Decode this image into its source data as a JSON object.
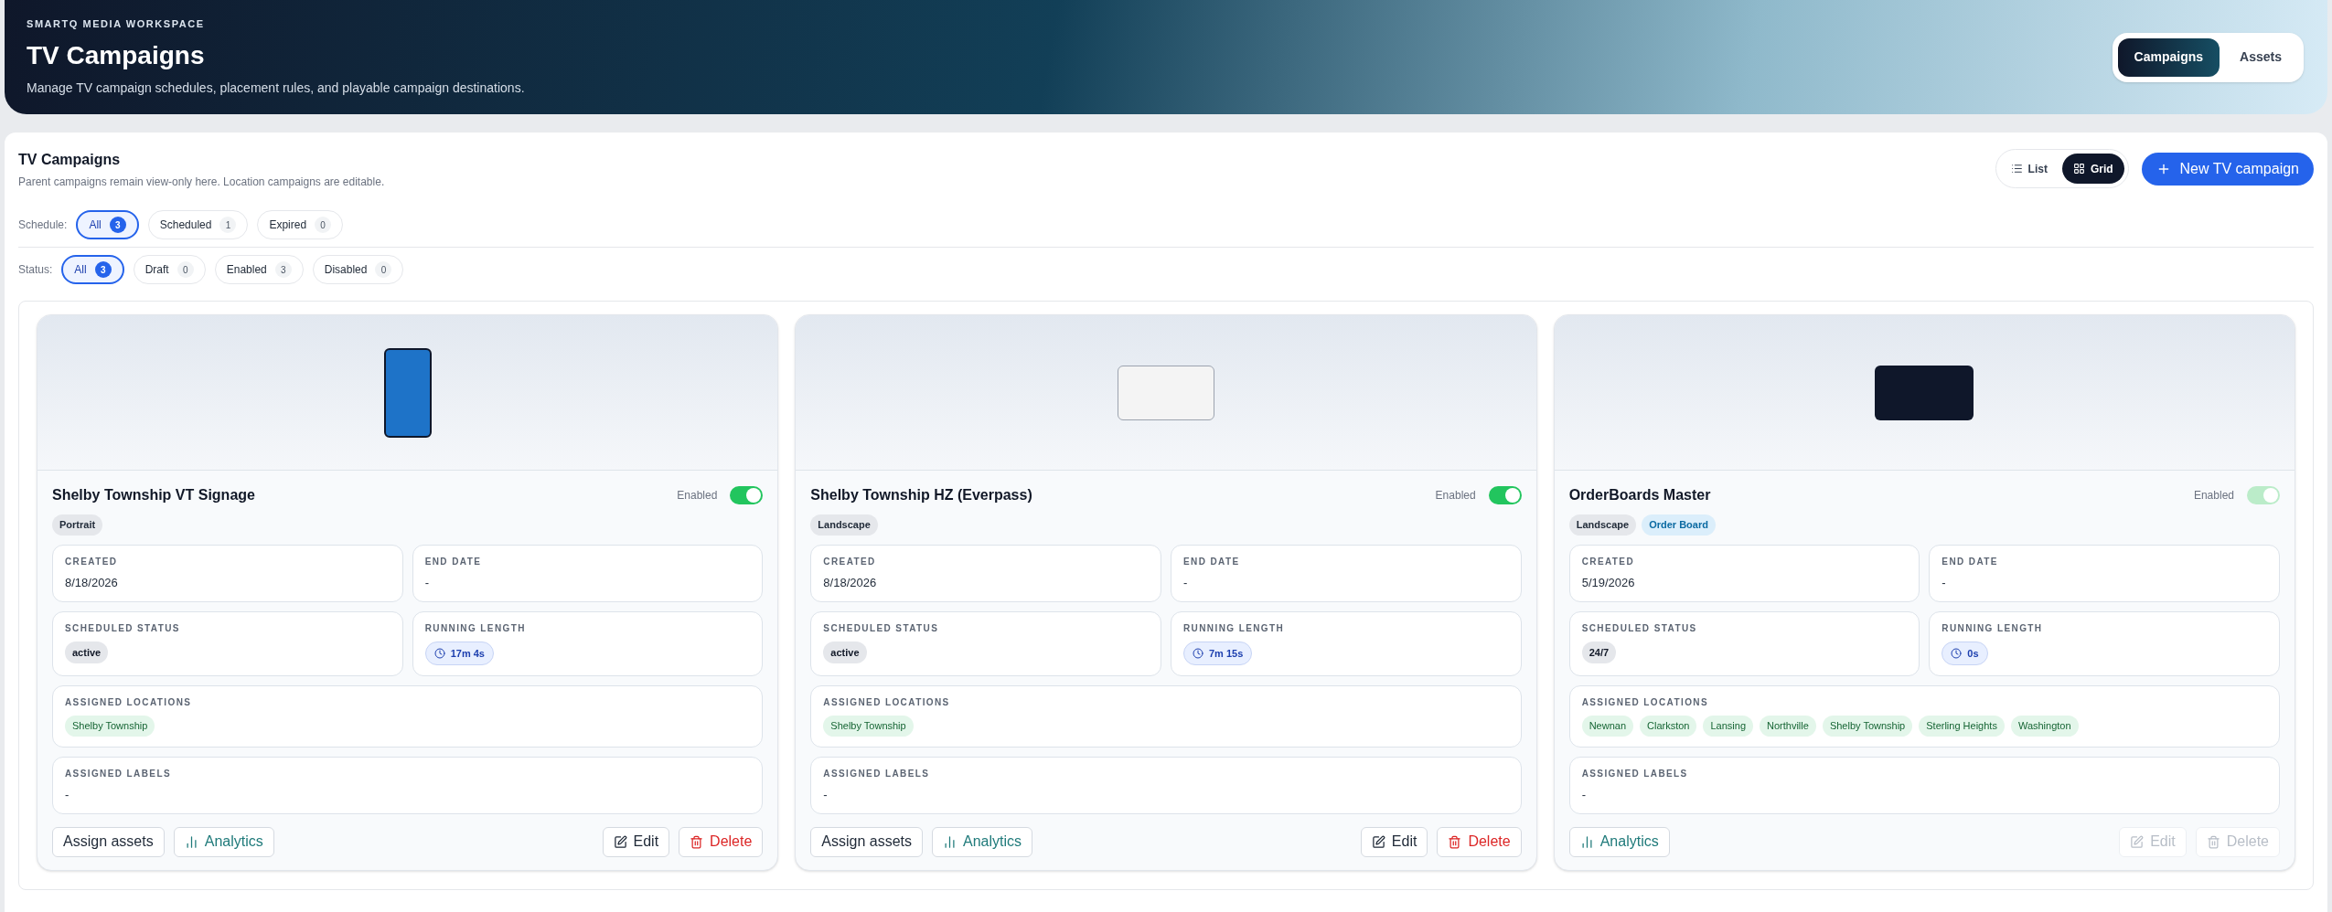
{
  "header": {
    "eyebrow": "SMARTQ MEDIA WORKSPACE",
    "title": "TV Campaigns",
    "subtitle": "Manage TV campaign schedules, placement rules, and playable campaign destinations.",
    "tabs": [
      {
        "label": "Campaigns",
        "selected": true
      },
      {
        "label": "Assets",
        "selected": false
      }
    ]
  },
  "panel": {
    "title": "TV Campaigns",
    "subtitle": "Parent campaigns remain view-only here. Location campaigns are editable.",
    "views": [
      {
        "label": "List",
        "kind": "list",
        "selected": false
      },
      {
        "label": "Grid",
        "kind": "grid",
        "selected": true
      }
    ],
    "new_button": "New TV campaign",
    "filters": [
      {
        "label": "Schedule:",
        "chips": [
          {
            "label": "All",
            "count": "3",
            "selected": true
          },
          {
            "label": "Scheduled",
            "count": "1",
            "selected": false
          },
          {
            "label": "Expired",
            "count": "0",
            "selected": false
          }
        ]
      },
      {
        "label": "Status:",
        "chips": [
          {
            "label": "All",
            "count": "3",
            "selected": true
          },
          {
            "label": "Draft",
            "count": "0",
            "selected": false
          },
          {
            "label": "Enabled",
            "count": "3",
            "selected": false
          },
          {
            "label": "Disabled",
            "count": "0",
            "selected": false
          }
        ]
      }
    ]
  },
  "cards": [
    {
      "thumbnail": {
        "kind": "portrait"
      },
      "title": "Shelby Township VT Signage",
      "toggle_label": "Enabled",
      "on": true,
      "toggle_disabled": false,
      "tags": [
        {
          "label": "Portrait",
          "kind": "orientation"
        }
      ],
      "created_label": "CREATED",
      "created": "8/18/2026",
      "end_label": "END DATE",
      "end": "-",
      "status_label": "SCHEDULED STATUS",
      "status": "active",
      "length_label": "RUNNING LENGTH",
      "length": "17m 4s",
      "locations_label": "ASSIGNED LOCATIONS",
      "locations": [
        "Shelby Township"
      ],
      "labels_label": "ASSIGNED LABELS",
      "labels": "-",
      "actions": [
        {
          "label": "Assign assets",
          "kind": "assign",
          "disabled": false
        },
        {
          "label": "Analytics",
          "kind": "analytics",
          "disabled": false
        },
        {
          "label": "Edit",
          "kind": "edit",
          "disabled": false
        },
        {
          "label": "Delete",
          "kind": "delete",
          "disabled": false
        }
      ]
    },
    {
      "thumbnail": {
        "kind": "landscape"
      },
      "title": "Shelby Township HZ (Everpass)",
      "toggle_label": "Enabled",
      "on": true,
      "toggle_disabled": false,
      "tags": [
        {
          "label": "Landscape",
          "kind": "orientation"
        }
      ],
      "created_label": "CREATED",
      "created": "8/18/2026",
      "end_label": "END DATE",
      "end": "-",
      "status_label": "SCHEDULED STATUS",
      "status": "active",
      "length_label": "RUNNING LENGTH",
      "length": "7m 15s",
      "locations_label": "ASSIGNED LOCATIONS",
      "locations": [
        "Shelby Township"
      ],
      "labels_label": "ASSIGNED LABELS",
      "labels": "-",
      "actions": [
        {
          "label": "Assign assets",
          "kind": "assign",
          "disabled": false
        },
        {
          "label": "Analytics",
          "kind": "analytics",
          "disabled": false
        },
        {
          "label": "Edit",
          "kind": "edit",
          "disabled": false
        },
        {
          "label": "Delete",
          "kind": "delete",
          "disabled": false
        }
      ]
    },
    {
      "thumbnail": {
        "kind": "dark"
      },
      "title": "OrderBoards Master",
      "toggle_label": "Enabled",
      "on": true,
      "toggle_disabled": true,
      "tags": [
        {
          "label": "Landscape",
          "kind": "orientation"
        },
        {
          "label": "Order Board",
          "kind": "type"
        }
      ],
      "created_label": "CREATED",
      "created": "5/19/2026",
      "end_label": "END DATE",
      "end": "-",
      "status_label": "SCHEDULED STATUS",
      "status": "24/7",
      "length_label": "RUNNING LENGTH",
      "length": "0s",
      "locations_label": "ASSIGNED LOCATIONS",
      "locations": [
        "Newnan",
        "Clarkston",
        "Lansing",
        "Northville",
        "Shelby Township",
        "Sterling Heights",
        "Washington"
      ],
      "labels_label": "ASSIGNED LABELS",
      "labels": "-",
      "actions": [
        {
          "label": "Analytics",
          "kind": "analytics",
          "disabled": false
        },
        {
          "label": "Edit",
          "kind": "edit",
          "disabled": true
        },
        {
          "label": "Delete",
          "kind": "delete",
          "disabled": true
        }
      ]
    }
  ]
}
